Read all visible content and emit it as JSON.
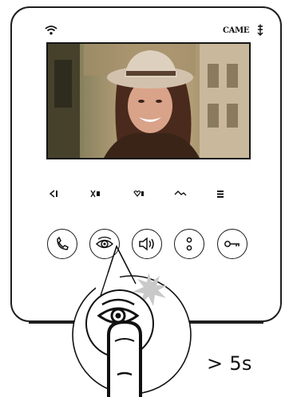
{
  "device": {
    "brand": "CAME",
    "icons": [
      "wifi-icon",
      "came-logo-mark-icon"
    ]
  },
  "screen": {
    "content": "video-feed",
    "colors": {
      "wall": "#b7a27a",
      "hat": "#d2c2ad",
      "hair": "#4a2a1c",
      "skin": "#d9a38a"
    }
  },
  "soft_keys": [
    "back-arrow-icon",
    "mute-icon",
    "heart-icon",
    "handshake-icon",
    "menu-icon"
  ],
  "buttons": [
    {
      "name": "call-button",
      "icon": "handset-icon"
    },
    {
      "name": "camera-view-button",
      "icon": "eye-icon"
    },
    {
      "name": "volume-button",
      "icon": "speaker-icon"
    },
    {
      "name": "options-button",
      "icon": "dots-icon"
    },
    {
      "name": "door-key-button",
      "icon": "key-icon"
    }
  ],
  "instruction": {
    "duration_label": "> 5s",
    "icons": [
      "burst-icon",
      "finger-press-icon"
    ]
  }
}
